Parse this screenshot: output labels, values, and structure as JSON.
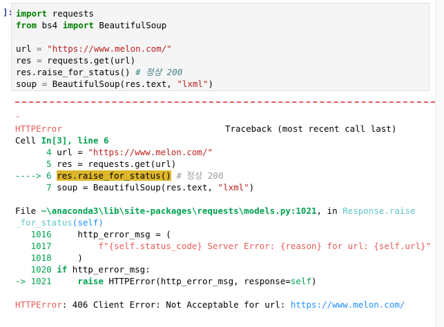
{
  "prompt": "]:",
  "code": {
    "kw_import": "import",
    "mod_requests": " requests",
    "kw_from": "from",
    "mod_bs4": " bs4 ",
    "kw_import2": "import",
    "cls_bs": " BeautifulSoup",
    "l4_pre": "url ",
    "l4_eq": "=",
    "l4_str": " \"https://www.melon.com/\"",
    "l5": "res ",
    "l5_eq": "=",
    "l5_rest": " requests.get(url)",
    "l6": "res.raise_for_status() ",
    "l6_cm": "# 정상 200",
    "l7": "soup ",
    "l7_eq": "=",
    "l7_rest": " BeautifulSoup(res.text, ",
    "l7_str": "\"lxml\"",
    "l7_end": ")"
  },
  "tb": {
    "dash": "-",
    "err_name": "HTTPError",
    "tb_header": "Traceback (most recent call last)",
    "cell_pre": "Cell ",
    "cell_loc": "In[3], line 6",
    "t4_no": "      4",
    "t4_code": " url = ",
    "t4_str": "\"https://www.melon.com/\"",
    "t5_no": "      5",
    "t5_code": " res = requests.get(url)",
    "t6_arrow": "----> 6",
    "t6_sp": " ",
    "t6_hl": "res.raise_for_status()",
    "t6_cm": " # 정상 200",
    "t7_no": "      7",
    "t7_code": " soup = BeautifulSoup(res.text, ",
    "t7_str": "\"lxml\"",
    "t7_end": ")",
    "file_pre": "File ",
    "file_path": "~\\anaconda3\\lib\\site-packages\\requests\\models.py:1021",
    "file_in": ", in ",
    "func1": "Response.raise",
    "func2": "_for_status",
    "func_args": "(self)",
    "f1016_no": "   1016",
    "f1016_code": "     http_error_msg = (",
    "f1017_no": "   1017",
    "f1017_code": "         f\"{self.status_code} Server Error: {reason} for url: {self.url}\"",
    "f1018_no": "   1018",
    "f1018_code": "     )",
    "f1020_no": "   1020",
    "f1020_kw": " if",
    "f1020_code": " http_error_msg:",
    "f1021_arrow": "-> 1021",
    "f1021_kw": "     raise",
    "f1021_code": " HTTPError(http_error_msg, response=",
    "f1021_self": "self",
    "f1021_end": ")",
    "final_name": "HTTPError",
    "final_msg": ": 406 Client Error: Not Acceptable for url: ",
    "final_url": "https://www.melon.com/"
  }
}
